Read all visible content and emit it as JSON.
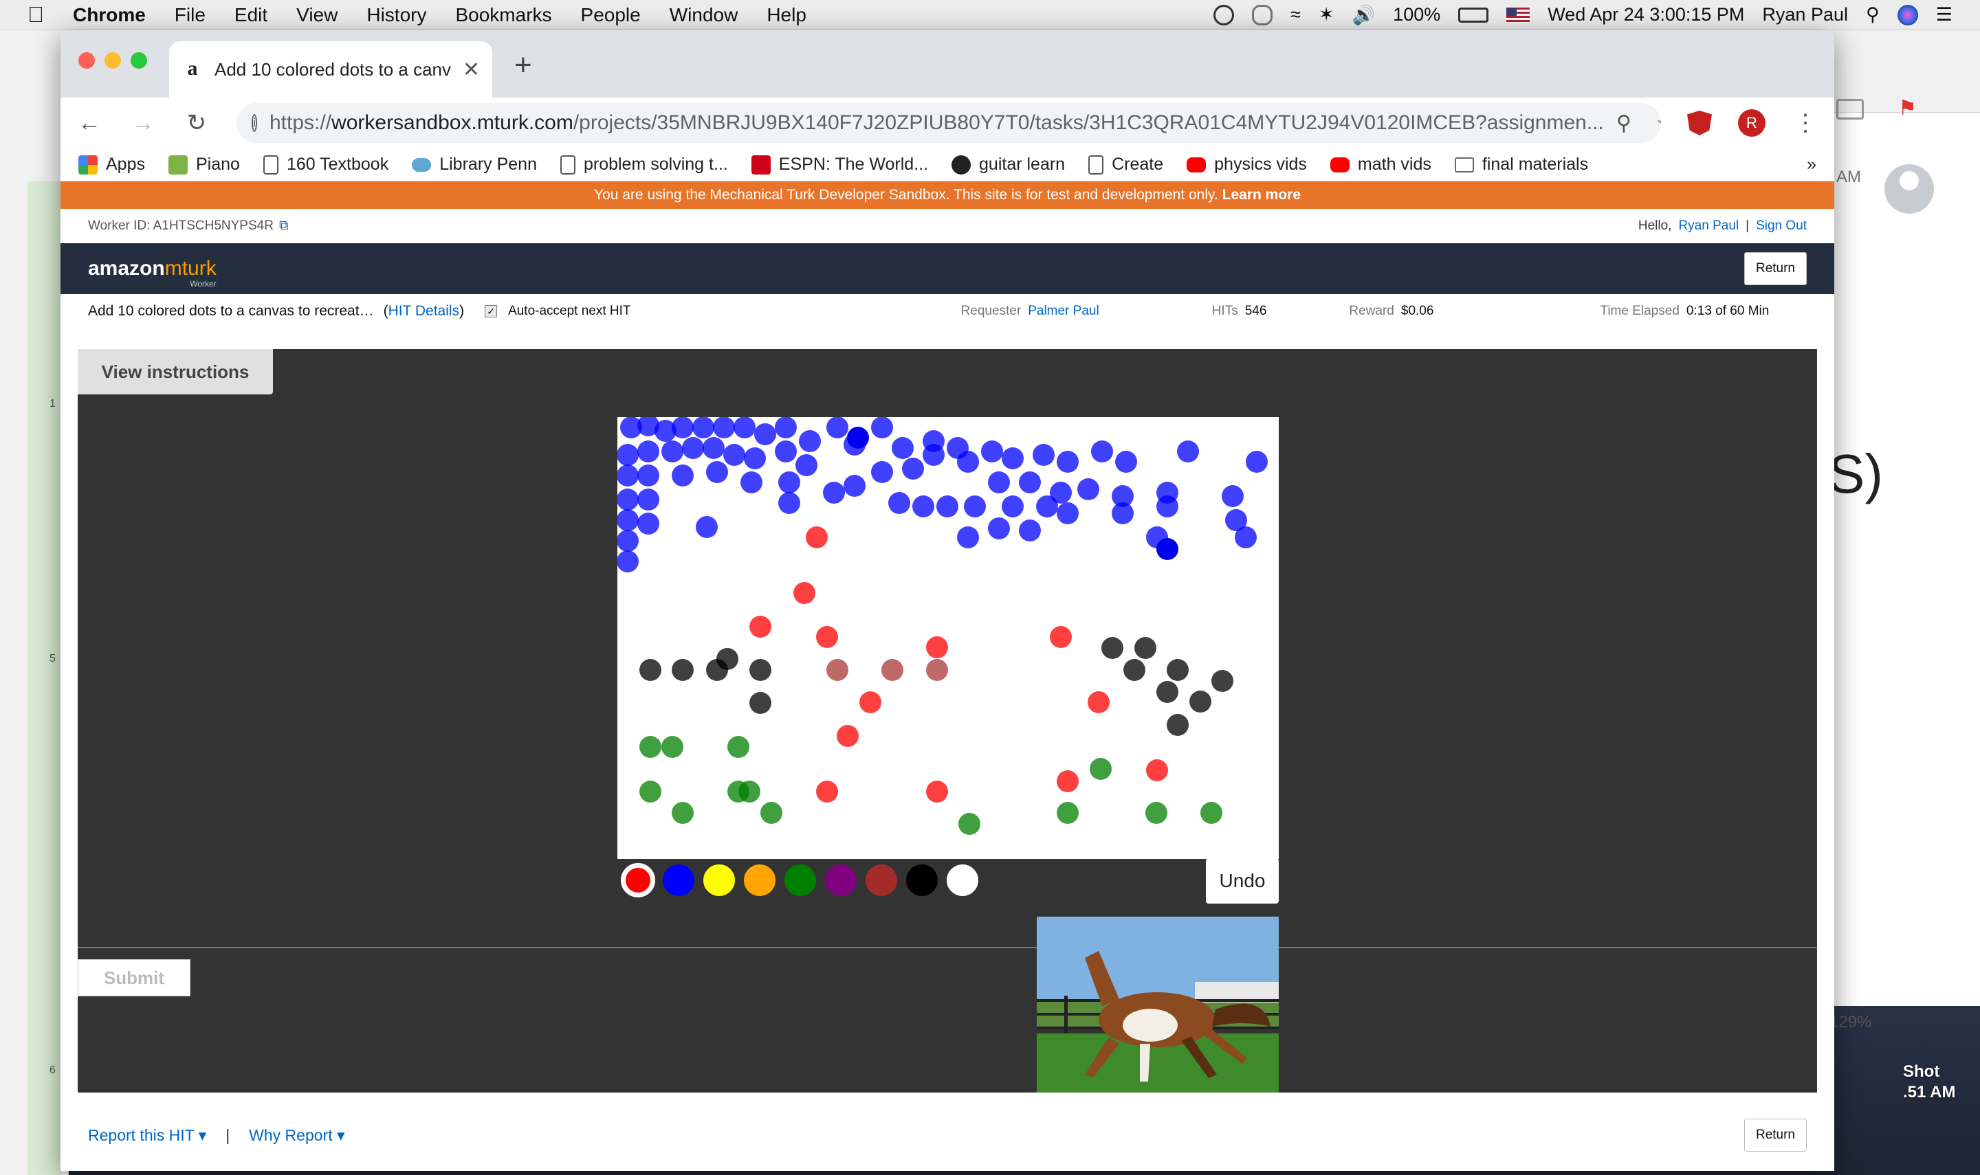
{
  "menubar": {
    "app": "Chrome",
    "menus": [
      "File",
      "Edit",
      "View",
      "History",
      "Bookmarks",
      "People",
      "Window",
      "Help"
    ],
    "battery": "100%",
    "clock": "Wed Apr 24  3:00:15 PM",
    "user": "Ryan Paul"
  },
  "background": {
    "right_window_time": "AM",
    "right_window_paren": "S)",
    "right_window_zoom": "129%",
    "desktop_file_label": "Shot\n.51 AM",
    "sheet_rows": [
      "1",
      "5",
      "6"
    ]
  },
  "tab": {
    "title": "Add 10 colored dots to a canva",
    "favicon": "a"
  },
  "omnibox": {
    "scheme": "https://",
    "domain": "workersandbox.mturk.com",
    "path": "/projects/35MNBRJU9BX140F7J20ZPIUB80Y7T0/tasks/3H1C3QRA01C4MYTU2J94V0120IMCEB?assignmen...",
    "profile_initial": "R"
  },
  "bookmarks": [
    {
      "label": "Apps",
      "icon": "apps-grid-icon",
      "color": "#4285f4"
    },
    {
      "label": "Piano",
      "icon": "piano-icon",
      "color": "#7cb342"
    },
    {
      "label": "160 Textbook",
      "icon": "page-icon",
      "color": "#ffffff"
    },
    {
      "label": "Library Penn",
      "icon": "cloud-icon",
      "color": "#5fa8d3"
    },
    {
      "label": "problem solving t...",
      "icon": "page-icon",
      "color": "#ffffff"
    },
    {
      "label": "ESPN: The World...",
      "icon": "espn-icon",
      "color": "#d0021b"
    },
    {
      "label": "guitar learn",
      "icon": "guitar-icon",
      "color": "#222222"
    },
    {
      "label": "Create",
      "icon": "page-icon",
      "color": "#ffffff"
    },
    {
      "label": "physics vids",
      "icon": "youtube-icon",
      "color": "#ff0000"
    },
    {
      "label": "math vids",
      "icon": "youtube-icon",
      "color": "#ff0000"
    },
    {
      "label": "final materials",
      "icon": "folder-icon",
      "color": "#777777"
    }
  ],
  "sandbox_banner": {
    "text": "You are using the Mechanical Turk Developer Sandbox. This site is for test and development only.",
    "link": "Learn more"
  },
  "worker": {
    "id_label": "Worker ID: A1HTSCH5NYPS4R",
    "hello": "Hello,",
    "name": "Ryan Paul",
    "sep": "|",
    "sign_out": "Sign Out"
  },
  "header": {
    "logo_main": "amazon",
    "logo_accent": "mturk",
    "logo_sub": "Worker",
    "return_label": "Return"
  },
  "hit": {
    "title": "Add 10 colored dots to a canvas to recreat…",
    "details_link": "HIT Details",
    "auto_accept": "Auto-accept next HIT",
    "requester_label": "Requester",
    "requester": "Palmer Paul",
    "hits_label": "HITs",
    "hits": "546",
    "reward_label": "Reward",
    "reward": "$0.06",
    "time_label": "Time Elapsed",
    "time": "0:13 of 60 Min"
  },
  "task": {
    "view_instructions": "View instructions",
    "undo": "Undo",
    "submit": "Submit",
    "palette": [
      "#ff0000",
      "#0000ff",
      "#ffff00",
      "#ffa500",
      "#008000",
      "#800080",
      "#a52a2a",
      "#000000",
      "#ffffff"
    ],
    "selected_color": "#ff0000"
  },
  "footer": {
    "report": "Report this HIT",
    "why": "Why Report",
    "return_label": "Return"
  }
}
